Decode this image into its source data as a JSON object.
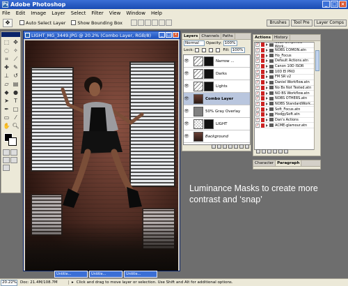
{
  "app": {
    "title": "Adobe Photoshop"
  },
  "menu": [
    "File",
    "Edit",
    "Image",
    "Layer",
    "Select",
    "Filter",
    "View",
    "Window",
    "Help"
  ],
  "options_bar": {
    "auto_select_label": "Auto Select Layer",
    "show_bounding_label": "Show Bounding Box",
    "palette_well": [
      "Brushes",
      "Tool Pre",
      "Layer Comps"
    ]
  },
  "document": {
    "title": "LIGHT_MG_3449.JPG @ 20.2% (Combo Layer, RGB/8)"
  },
  "layers_panel": {
    "tabs": [
      "Layers",
      "Channels",
      "Paths"
    ],
    "blend_mode": "Normal",
    "opacity_label": "Opacity:",
    "opacity_value": "100%",
    "lock_label": "Lock:",
    "fill_label": "Fill:",
    "fill_value": "100%",
    "layers": [
      {
        "name": "Narrow ...",
        "thumb": "adj",
        "mask": true,
        "selected": false,
        "style": ""
      },
      {
        "name": "Darks",
        "thumb": "adj",
        "mask": true,
        "selected": false,
        "style": ""
      },
      {
        "name": "Lights",
        "thumb": "adj",
        "mask": true,
        "selected": false,
        "style": ""
      },
      {
        "name": "Combo Layer",
        "thumb": "photo",
        "mask": false,
        "selected": true,
        "style": "bold"
      },
      {
        "name": "50% Gray Overlay",
        "thumb": "gray",
        "mask": false,
        "selected": false,
        "style": ""
      },
      {
        "name": "LIGHT",
        "thumb": "empty",
        "mask": true,
        "selected": false,
        "style": ""
      },
      {
        "name": "Background",
        "thumb": "photo",
        "mask": false,
        "selected": false,
        "style": "italic"
      }
    ]
  },
  "actions_panel": {
    "tabs": [
      "Actions",
      "History"
    ],
    "items": [
      "NoBs Simplified Work...",
      "NOBS COMON.atn",
      "Ho_Focus",
      "Default Actions.atn",
      "Canon 10D ISOR",
      "10D EI PRO",
      "FM SR v2",
      "Daniel Workflow.atn",
      "No Bs Not Tested.atn",
      "NO BS Workflow.atn",
      "NOBS OTHERS.atn",
      "NOBS StandardWork...",
      "Soft_Focus.atn",
      "HodgySoft.atn",
      "Dan's Actions",
      "ACME-glamour.atn"
    ]
  },
  "char_panel": {
    "tabs": [
      "Character",
      "Paragraph"
    ]
  },
  "caption": {
    "line1": "Luminance Masks to create more",
    "line2": "contrast and ‘snap’"
  },
  "minimized_docs": [
    "Untitle...",
    "Untitle...",
    "Untitle..."
  ],
  "status": {
    "zoom": "20.22%",
    "doc_size": "Doc: 21.4M/108.7M",
    "hint": "Click and drag to move layer or selection.  Use Shift and Alt for additional options."
  }
}
